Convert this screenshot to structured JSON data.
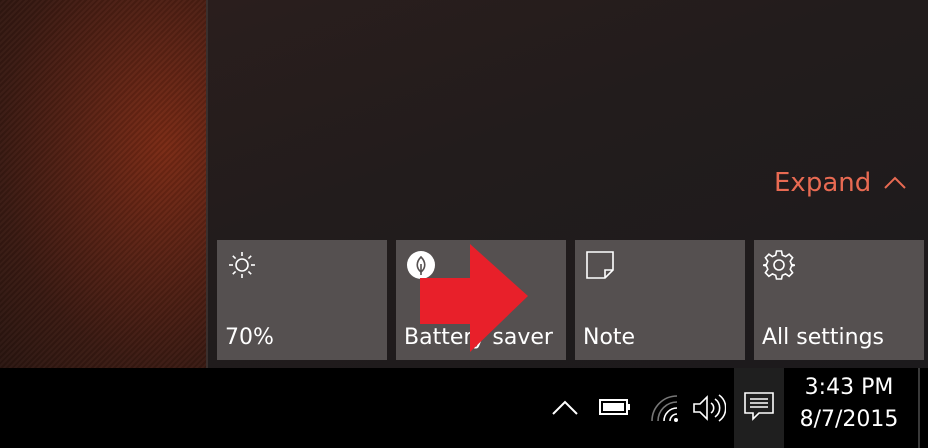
{
  "action_center": {
    "expand_label": "Expand",
    "tiles": [
      {
        "label": "70%",
        "icon": "brightness-icon"
      },
      {
        "label": "Battery saver",
        "icon": "battery-saver-icon"
      },
      {
        "label": "Note",
        "icon": "note-icon"
      },
      {
        "label": "All settings",
        "icon": "gear-icon"
      }
    ]
  },
  "taskbar": {
    "tray_icons": [
      "chevron-up-icon",
      "battery-icon",
      "wifi-icon",
      "volume-icon",
      "action-center-icon"
    ],
    "clock": {
      "time": "3:43 PM",
      "date": "8/7/2015"
    }
  },
  "colors": {
    "accent": "#e86a52",
    "tile_bg": "#555050",
    "arrow": "#e8202a"
  }
}
